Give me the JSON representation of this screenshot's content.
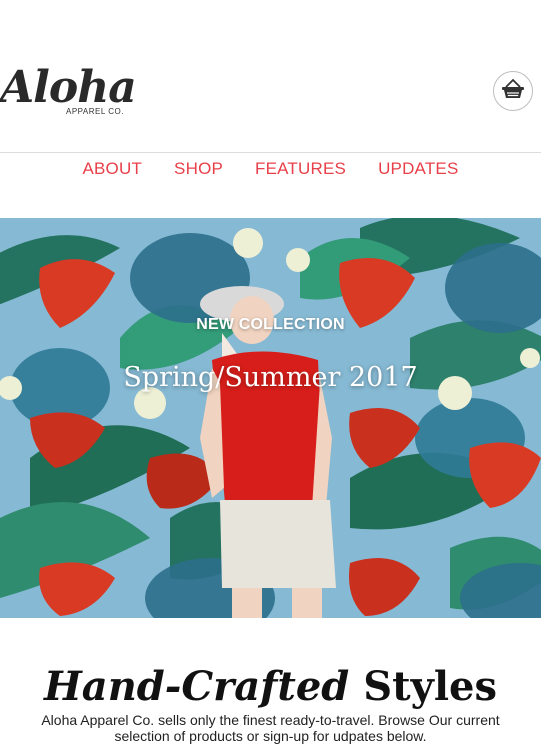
{
  "brand": {
    "logo_main": "Aloha",
    "logo_sub": "APPAREL CO."
  },
  "header": {
    "cart_icon": "basket-icon"
  },
  "nav": {
    "items": [
      "ABOUT",
      "SHOP",
      "FEATURES",
      "UPDATES"
    ]
  },
  "hero": {
    "kicker": "NEW COLLECTION",
    "title": "Spring/Summer 2017"
  },
  "section": {
    "title_italic": "Hand-Crafted",
    "title_bold": "Styles",
    "intro": "Aloha Apparel Co. sells only the finest ready-to-travel. Browse Our current selection of products or sign-up for udpates below."
  },
  "colors": {
    "accent": "#e8404a",
    "hero_bg": "#86b9d3",
    "text": "#111111"
  }
}
